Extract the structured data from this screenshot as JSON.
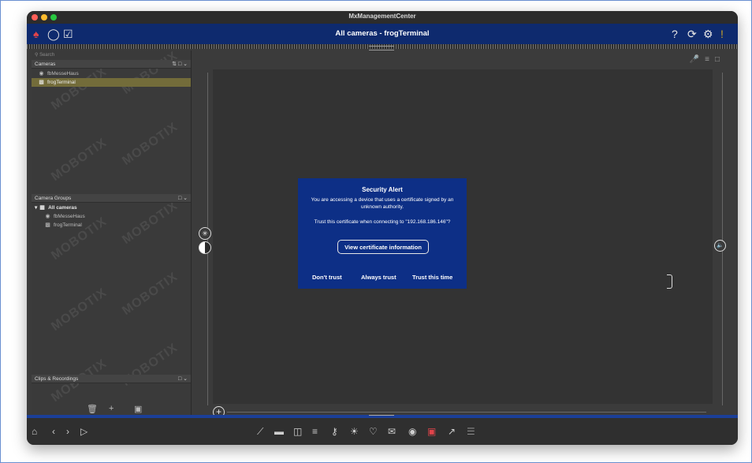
{
  "window": {
    "title": "MxManagementCenter"
  },
  "appbar": {
    "title": "All cameras - frogTerminal",
    "help_glyph": "?",
    "refresh_glyph": "⟳",
    "settings_glyph": "⚙",
    "alert_glyph": "!"
  },
  "sidebar": {
    "search_placeholder": "Search",
    "cameras_header": "Cameras",
    "cameras": [
      {
        "label": "fbMesseHaus"
      },
      {
        "label": "frogTerminal",
        "selected": true
      }
    ],
    "groups_header": "Camera Groups",
    "groups_root": "All cameras",
    "group_items": [
      {
        "label": "fbMesseHaus"
      },
      {
        "label": "frogTerminal"
      }
    ],
    "clips_header": "Clips & Recordings",
    "watermark": "MOBOTIX"
  },
  "dialog": {
    "title": "Security Alert",
    "message": "You are accessing a device that uses a certificate signed by an unknown authority.",
    "trust_prompt": "Trust this certificate when connecting to \"192.168.186.146\"?",
    "view_button": "View certificate information",
    "dont_trust": "Don't trust",
    "always_trust": "Always trust",
    "trust_once": "Trust this time"
  },
  "colors": {
    "appbar": "#0e2a6e",
    "dialog": "#0d2f86",
    "selection": "#736c3a"
  },
  "bottom_toolbar": {
    "icons": [
      "home-icon",
      "back-icon",
      "forward-icon",
      "play-icon",
      "wand-icon",
      "bar-icon",
      "door-icon",
      "mic-icon",
      "thermo-icon",
      "light-icon",
      "bell-icon",
      "mail-icon",
      "camera-icon",
      "video-icon",
      "share-icon",
      "list-icon"
    ]
  }
}
